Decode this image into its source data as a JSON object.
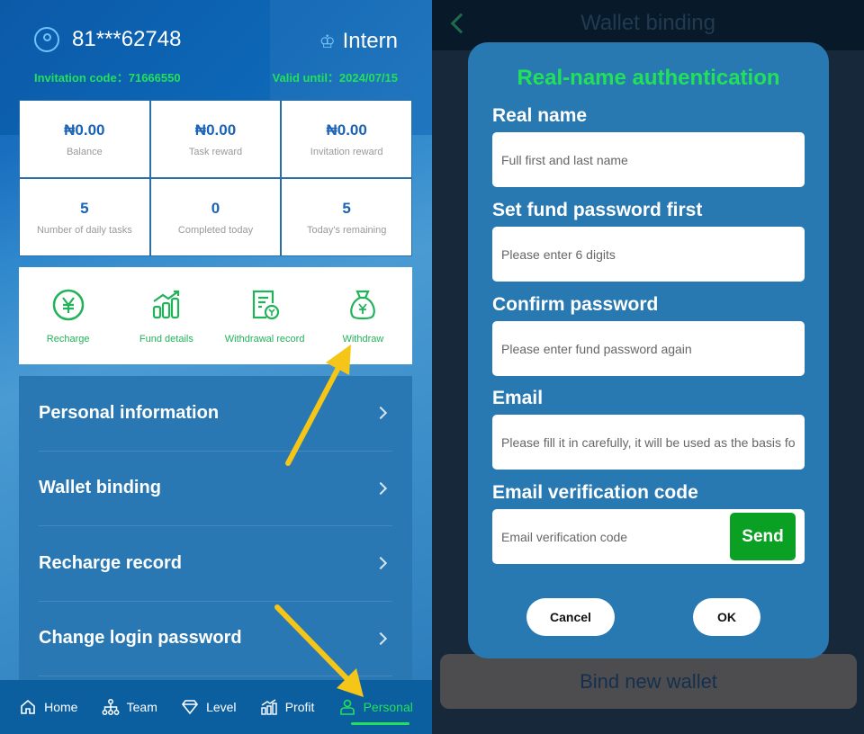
{
  "left": {
    "header": {
      "user_id": "81***62748",
      "level": "Intern",
      "invitation_code": "Invitation code：71666550",
      "valid_until": "Valid until：2024/07/15"
    },
    "stats": [
      {
        "value": "₦0.00",
        "label": "Balance"
      },
      {
        "value": "₦0.00",
        "label": "Task reward"
      },
      {
        "value": "₦0.00",
        "label": "Invitation reward"
      },
      {
        "value": "5",
        "label": "Number of daily tasks"
      },
      {
        "value": "0",
        "label": "Completed today"
      },
      {
        "value": "5",
        "label": "Today's remaining"
      }
    ],
    "quick_actions": [
      {
        "label": "Recharge",
        "icon": "yen-circle-icon"
      },
      {
        "label": "Fund details",
        "icon": "bar-chart-icon"
      },
      {
        "label": "Withdrawal record",
        "icon": "document-yen-icon"
      },
      {
        "label": "Withdraw",
        "icon": "money-bag-icon"
      }
    ],
    "menu": [
      {
        "label": "Personal information"
      },
      {
        "label": "Wallet binding"
      },
      {
        "label": "Recharge record"
      },
      {
        "label": "Change login password"
      }
    ],
    "tabbar": [
      {
        "label": "Home",
        "icon": "home-icon",
        "active": false
      },
      {
        "label": "Team",
        "icon": "team-icon",
        "active": false
      },
      {
        "label": "Level",
        "icon": "diamond-icon",
        "active": false
      },
      {
        "label": "Profit",
        "icon": "profit-icon",
        "active": false
      },
      {
        "label": "Personal",
        "icon": "person-icon",
        "active": true
      }
    ],
    "accent_color": "#22e05a",
    "annotation_color": "#f5c518"
  },
  "right": {
    "page_title": "Wallet binding",
    "bind_button": "Bind new wallet",
    "modal": {
      "title": "Real-name authentication",
      "fields": [
        {
          "label": "Real name",
          "placeholder": "Full first and last name"
        },
        {
          "label": "Set fund password first",
          "placeholder": "Please enter 6 digits"
        },
        {
          "label": "Confirm password",
          "placeholder": "Please enter fund password again"
        },
        {
          "label": "Email",
          "placeholder": "Please fill it in carefully, it will be used as the basis fo"
        },
        {
          "label": "Email verification code",
          "placeholder": "Email verification code"
        }
      ],
      "send_label": "Send",
      "cancel_label": "Cancel",
      "ok_label": "OK"
    }
  }
}
